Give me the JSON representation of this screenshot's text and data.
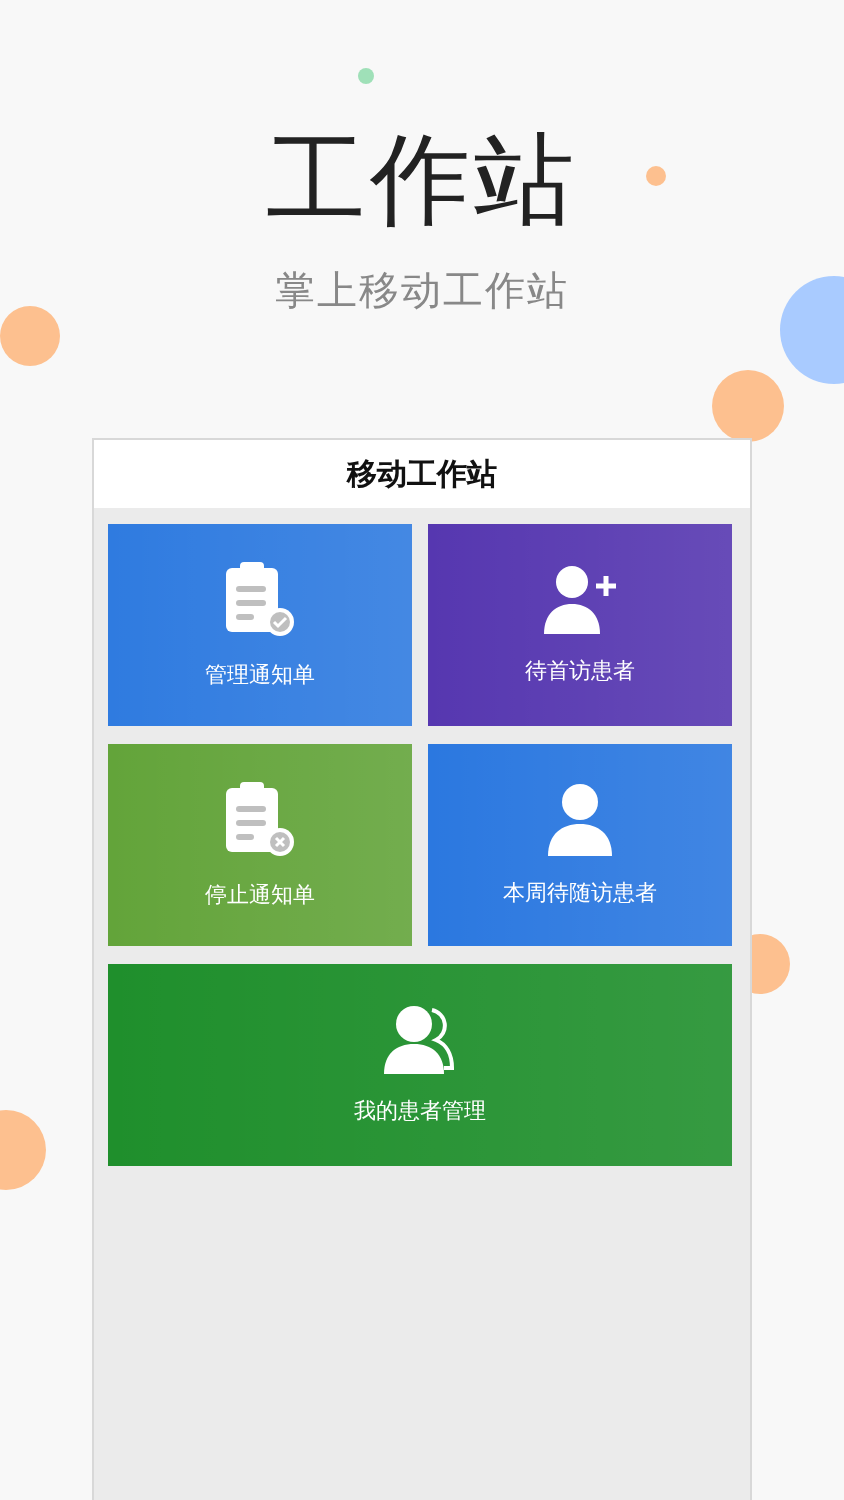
{
  "hero": {
    "title": "工作站",
    "subtitle": "掌上移动工作站"
  },
  "screen": {
    "title": "移动工作站"
  },
  "tiles": [
    {
      "label": "管理通知单",
      "kind": "clipboard-check",
      "color": "#2f7be0",
      "wide": false
    },
    {
      "label": "待首访患者",
      "kind": "user-plus",
      "color": "#5637b0",
      "wide": false
    },
    {
      "label": "停止通知单",
      "kind": "clipboard-x",
      "color": "#63a43a",
      "wide": false
    },
    {
      "label": "本周待随访患者",
      "kind": "user",
      "color": "#2b78e0",
      "wide": false
    },
    {
      "label": "我的患者管理",
      "kind": "users",
      "color": "#1f8f2c",
      "wide": true
    }
  ]
}
